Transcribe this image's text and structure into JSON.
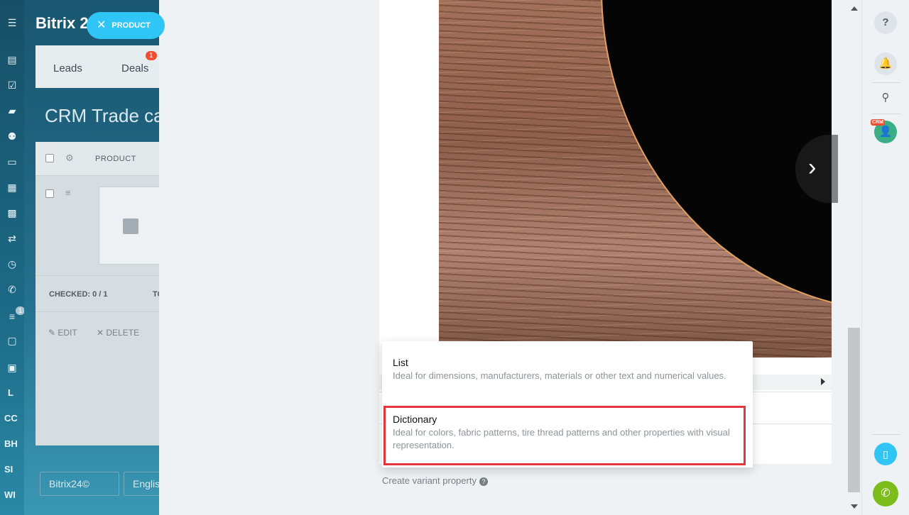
{
  "sidebar": {
    "text_items": [
      "L",
      "CC",
      "BH",
      "SI",
      "WI"
    ],
    "badge": "1"
  },
  "app": {
    "brand": "Bitrix 2",
    "product_pill": "PRODUCT",
    "tabs": [
      {
        "label": "Leads"
      },
      {
        "label": "Deals",
        "badge": "1"
      }
    ],
    "page_title": "CRM Trade cat",
    "grid": {
      "column_product": "PRODUCT",
      "checked_label": "CHECKED: 0 / 1",
      "total_label": "TO",
      "edit_label": "EDIT",
      "delete_label": "DELETE"
    },
    "bottom_buttons": [
      "Bitrix24©",
      "Englis"
    ]
  },
  "popup": {
    "options": [
      {
        "title": "List",
        "description": "Ideal for dimensions, manufacturers, materials or other text and numerical values."
      },
      {
        "title": "Dictionary",
        "description": "Ideal for colors, fabric patterns, tire thread patterns and other properties with visual representation."
      }
    ],
    "highlighted_option": "Dictionary",
    "highlight_color": "#e5373b"
  },
  "create_variant": "Create variant property",
  "rightbar": {
    "avatar_tag": "CRM"
  },
  "colors": {
    "accent": "#2fc6f6",
    "call": "#7cbc1b",
    "badge": "#ee4d30"
  }
}
